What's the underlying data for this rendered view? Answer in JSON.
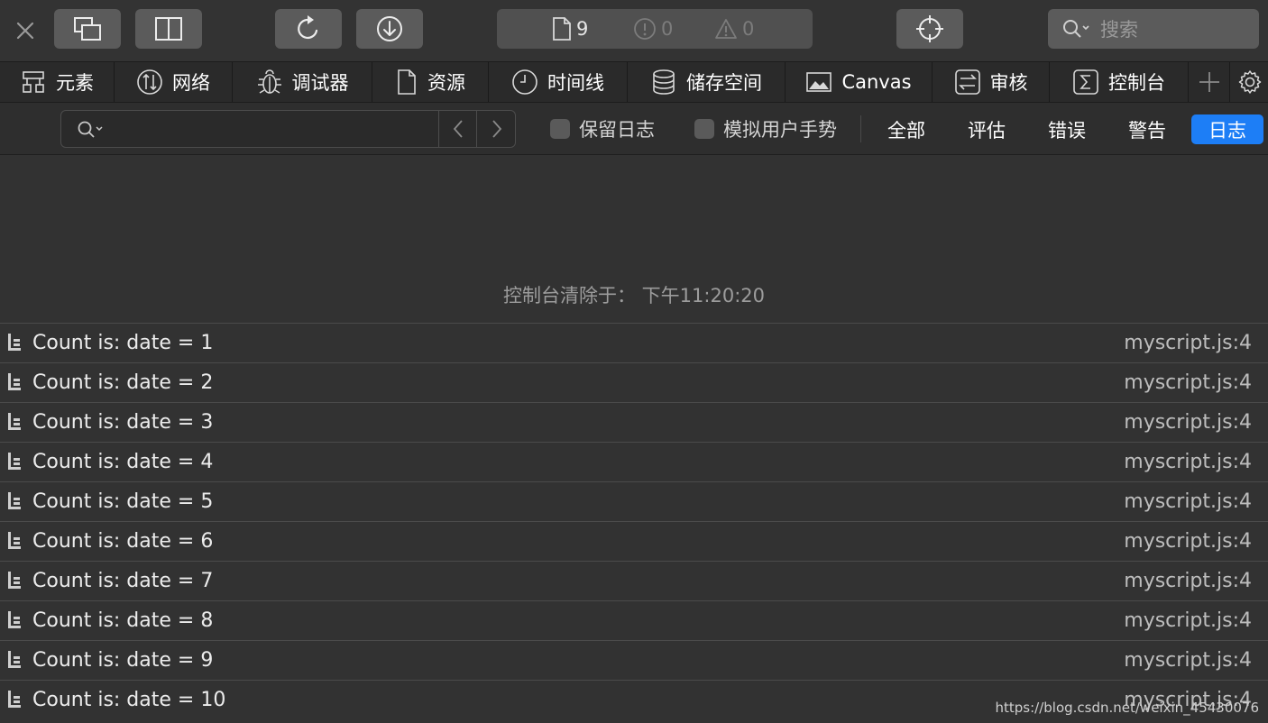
{
  "toolbar": {
    "resource_count": "9",
    "error_count": "0",
    "warning_count": "0",
    "search_placeholder": "搜索"
  },
  "tabs": [
    {
      "label": "元素",
      "icon": "elements-icon"
    },
    {
      "label": "网络",
      "icon": "network-icon"
    },
    {
      "label": "调试器",
      "icon": "debugger-bug-icon"
    },
    {
      "label": "资源",
      "icon": "document-icon"
    },
    {
      "label": "时间线",
      "icon": "clock-icon"
    },
    {
      "label": "储存空间",
      "icon": "database-icon"
    },
    {
      "label": "Canvas",
      "icon": "image-icon"
    },
    {
      "label": "审核",
      "icon": "audit-icon"
    },
    {
      "label": "控制台",
      "icon": "console-icon"
    }
  ],
  "filter": {
    "search_value": "",
    "preserve_log": "保留日志",
    "emulate_gesture": "模拟用户手势",
    "levels": [
      "全部",
      "评估",
      "错误",
      "警告",
      "日志"
    ],
    "active_level": "日志"
  },
  "console": {
    "cleared_message": "控制台清除于： 下午11:20:20",
    "logs": [
      {
        "message": "Count is: date = 1",
        "source": "myscript.js:4"
      },
      {
        "message": "Count is: date = 2",
        "source": "myscript.js:4"
      },
      {
        "message": "Count is: date = 3",
        "source": "myscript.js:4"
      },
      {
        "message": "Count is: date = 4",
        "source": "myscript.js:4"
      },
      {
        "message": "Count is: date = 5",
        "source": "myscript.js:4"
      },
      {
        "message": "Count is: date = 6",
        "source": "myscript.js:4"
      },
      {
        "message": "Count is: date = 7",
        "source": "myscript.js:4"
      },
      {
        "message": "Count is: date = 8",
        "source": "myscript.js:4"
      },
      {
        "message": "Count is: date = 9",
        "source": "myscript.js:4"
      },
      {
        "message": "Count is: date = 10",
        "source": "myscript.js:4"
      }
    ]
  },
  "watermark": "https://blog.csdn.net/weixin_45430076",
  "colors": {
    "active_filter": "#1d7ef6",
    "background": "#323232"
  }
}
